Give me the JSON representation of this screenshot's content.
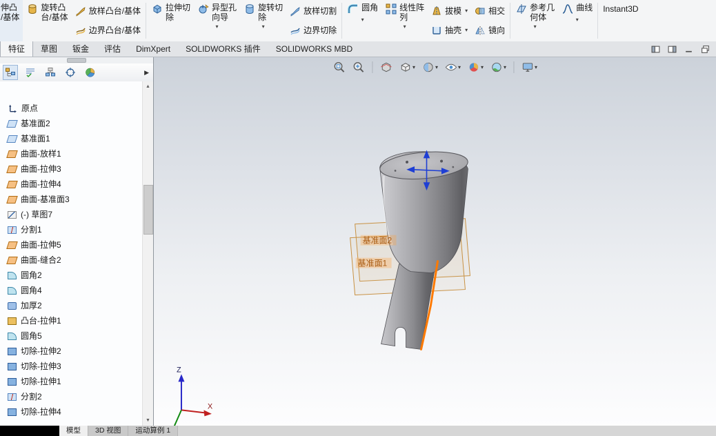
{
  "ribbon": {
    "buttons": {
      "extrude_boss": {
        "line1": "伸凸",
        "line2": "/基体"
      },
      "revolve_boss": {
        "line1": "旋转凸",
        "line2": "台/基体"
      },
      "loft_boss": {
        "label": "放样凸台/基体"
      },
      "boundary_boss": {
        "label": "边界凸台/基体"
      },
      "extrude_cut": {
        "line1": "拉伸切",
        "line2": "除"
      },
      "hole_wizard": {
        "line1": "异型孔",
        "line2": "向导"
      },
      "revolve_cut": {
        "line1": "旋转切",
        "line2": "除"
      },
      "loft_cut": {
        "label": "放样切割"
      },
      "boundary_cut": {
        "label": "边界切除"
      },
      "fillet": {
        "label": "圆角"
      },
      "linear_pattern": {
        "line1": "线性阵",
        "line2": "列"
      },
      "draft": {
        "label": "拔模"
      },
      "shell": {
        "label": "抽壳"
      },
      "intersect": {
        "label": "相交"
      },
      "mirror": {
        "label": "镜向"
      },
      "reference_geometry": {
        "line1": "参考几",
        "line2": "何体"
      },
      "curve": {
        "label": "曲线"
      },
      "instant3d": {
        "label": "Instant3D"
      }
    }
  },
  "tabs": {
    "items": [
      {
        "label": "特征",
        "active": true
      },
      {
        "label": "草图"
      },
      {
        "label": "钣金"
      },
      {
        "label": "评估"
      },
      {
        "label": "DimXpert"
      },
      {
        "label": "SOLIDWORKS 插件"
      },
      {
        "label": "SOLIDWORKS MBD"
      }
    ]
  },
  "tree": {
    "items": [
      {
        "icon": "origin",
        "label": "原点"
      },
      {
        "icon": "plane",
        "label": "基准面2"
      },
      {
        "icon": "plane",
        "label": "基准面1"
      },
      {
        "icon": "surface",
        "label": "曲面-放样1"
      },
      {
        "icon": "surface",
        "label": "曲面-拉伸3"
      },
      {
        "icon": "surface",
        "label": "曲面-拉伸4"
      },
      {
        "icon": "surface",
        "label": "曲面-基准面3"
      },
      {
        "icon": "sketch",
        "label": "(-) 草图7"
      },
      {
        "icon": "split",
        "label": "分割1"
      },
      {
        "icon": "surface",
        "label": "曲面-拉伸5"
      },
      {
        "icon": "surface",
        "label": "曲面-缝合2"
      },
      {
        "icon": "fillet",
        "label": "圆角2"
      },
      {
        "icon": "fillet",
        "label": "圆角4"
      },
      {
        "icon": "thicken",
        "label": "加厚2"
      },
      {
        "icon": "boss",
        "label": "凸台-拉伸1"
      },
      {
        "icon": "fillet",
        "label": "圆角5"
      },
      {
        "icon": "cut",
        "label": "切除-拉伸2"
      },
      {
        "icon": "cut",
        "label": "切除-拉伸3"
      },
      {
        "icon": "cut",
        "label": "切除-拉伸1"
      },
      {
        "icon": "split",
        "label": "分割2"
      },
      {
        "icon": "cut",
        "label": "切除-拉伸4"
      }
    ]
  },
  "viewport": {
    "hud_icons": [
      "zoom-fit",
      "zoom-area",
      "section-view",
      "view-orientation",
      "display-style",
      "hide-show-items",
      "edit-appearance",
      "apply-scene",
      "view-settings"
    ],
    "planes": [
      {
        "label": "基准面2"
      },
      {
        "label": "基准面1"
      }
    ],
    "triad": {
      "x": "X",
      "z": "Z"
    }
  },
  "statusbar": {
    "tabs": [
      {
        "label": "模型",
        "active": true
      },
      {
        "label": "3D 视图"
      },
      {
        "label": "运动算例 1"
      }
    ]
  },
  "colors": {
    "selection_orange": "#ff7a00",
    "plane_border": "#c89143",
    "plane_label": "#a85a10",
    "boss_gold": "#e6b54a",
    "cut_blue": "#8fbce8"
  }
}
